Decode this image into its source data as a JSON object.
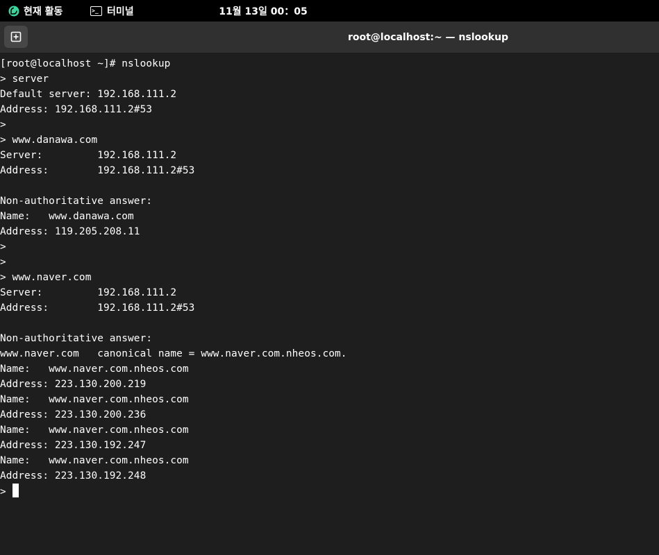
{
  "topbar": {
    "activities_label": "현재 활동",
    "app_name": "터미널",
    "clock": "11월 13일  00：05"
  },
  "window": {
    "title": "root@localhost:~ — nslookup"
  },
  "terminal": {
    "lines": [
      "[root@localhost ~]# nslookup",
      "> server",
      "Default server: 192.168.111.2",
      "Address: 192.168.111.2#53",
      ">",
      "> www.danawa.com",
      "Server:         192.168.111.2",
      "Address:        192.168.111.2#53",
      "",
      "Non-authoritative answer:",
      "Name:   www.danawa.com",
      "Address: 119.205.208.11",
      ">",
      ">",
      "> www.naver.com",
      "Server:         192.168.111.2",
      "Address:        192.168.111.2#53",
      "",
      "Non-authoritative answer:",
      "www.naver.com   canonical name = www.naver.com.nheos.com.",
      "Name:   www.naver.com.nheos.com",
      "Address: 223.130.200.219",
      "Name:   www.naver.com.nheos.com",
      "Address: 223.130.200.236",
      "Name:   www.naver.com.nheos.com",
      "Address: 223.130.192.247",
      "Name:   www.naver.com.nheos.com",
      "Address: 223.130.192.248"
    ],
    "prompt": "> "
  }
}
